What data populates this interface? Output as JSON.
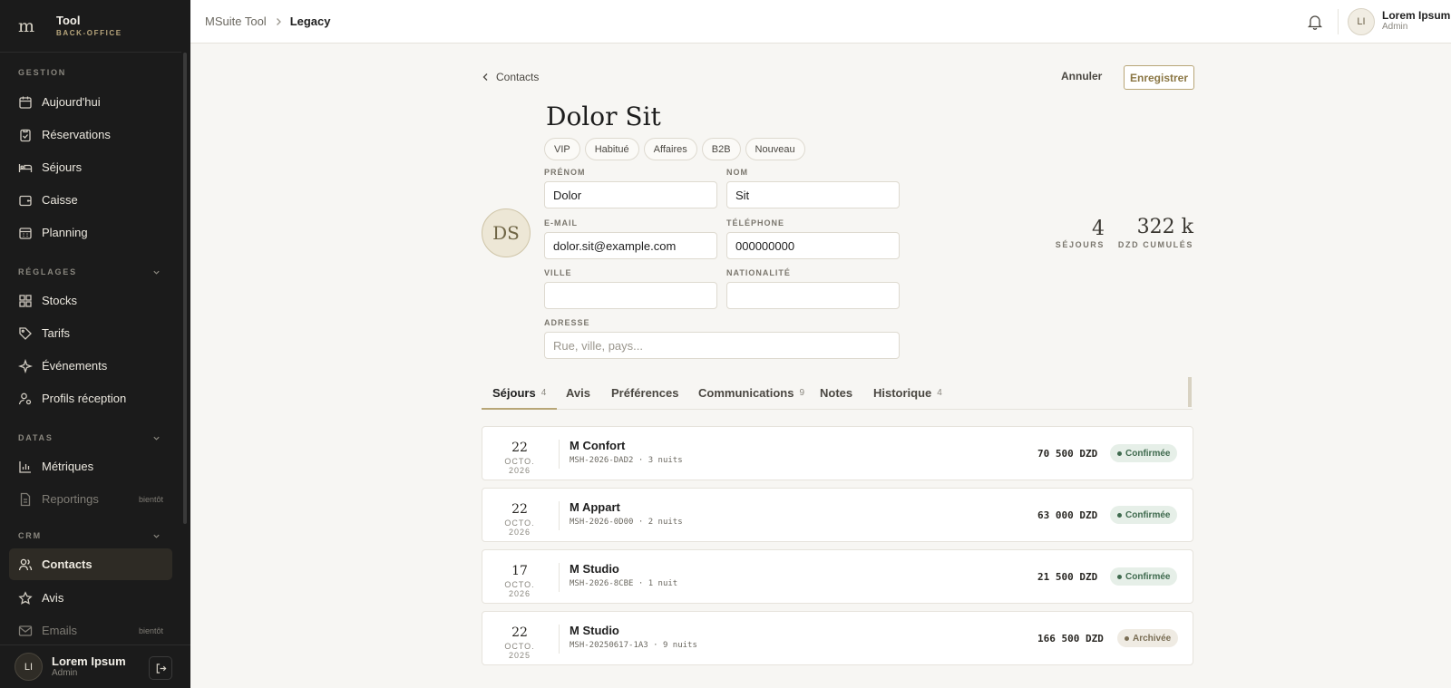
{
  "sidebar": {
    "brand": {
      "name": "Tool",
      "sub": "BACK-OFFICE"
    },
    "sections": {
      "gestion": "GESTION",
      "reglages": "RÉGLAGES",
      "datas": "DATAS",
      "crm": "CRM"
    },
    "items": [
      {
        "label": "Aujourd'hui",
        "icon": "calendar-icon"
      },
      {
        "label": "Réservations",
        "icon": "clipboard-icon"
      },
      {
        "label": "Séjours",
        "icon": "bed-icon"
      },
      {
        "label": "Caisse",
        "icon": "wallet-icon"
      },
      {
        "label": "Planning",
        "icon": "calendar-grid-icon"
      },
      {
        "label": "Stocks",
        "icon": "grid-icon"
      },
      {
        "label": "Tarifs",
        "icon": "tag-icon"
      },
      {
        "label": "Événements",
        "icon": "sparkle-icon"
      },
      {
        "label": "Profils réception",
        "icon": "user-cog-icon"
      },
      {
        "label": "Métriques",
        "icon": "bar-chart-icon"
      },
      {
        "label": "Reportings",
        "icon": "document-icon",
        "soon": "bientôt"
      },
      {
        "label": "Contacts",
        "icon": "users-icon",
        "active": true
      },
      {
        "label": "Avis",
        "icon": "star-icon"
      },
      {
        "label": "Emails",
        "icon": "mail-icon",
        "soon": "bientôt"
      }
    ],
    "user": {
      "initials": "LI",
      "name": "Lorem Ipsum",
      "role": "Admin"
    }
  },
  "topbar": {
    "breadcrumb_root": "MSuite Tool",
    "breadcrumb_current": "Legacy",
    "user": {
      "initials": "LI",
      "name": "Lorem Ipsum",
      "role": "Admin"
    }
  },
  "header": {
    "back_label": "Contacts",
    "cancel_label": "Annuler",
    "save_label": "Enregistrer",
    "full_name": "Dolor Sit",
    "initials": "DS",
    "tags": [
      "VIP",
      "Habitué",
      "Affaires",
      "B2B",
      "Nouveau"
    ]
  },
  "form": {
    "prenom": {
      "label": "PRÉNOM",
      "value": "Dolor"
    },
    "nom": {
      "label": "NOM",
      "value": "Sit"
    },
    "email": {
      "label": "E-MAIL",
      "value": "dolor.sit@example.com"
    },
    "telephone": {
      "label": "TÉLÉPHONE",
      "value": "000000000"
    },
    "ville": {
      "label": "VILLE",
      "value": ""
    },
    "nationalite": {
      "label": "NATIONALITÉ",
      "value": ""
    },
    "adresse": {
      "label": "ADRESSE",
      "value": "",
      "placeholder": "Rue, ville, pays..."
    }
  },
  "stats": {
    "sejours": {
      "value": "4",
      "label": "SÉJOURS"
    },
    "cumul": {
      "value": "322 k",
      "label": "DZD CUMULÉS"
    }
  },
  "tabs": [
    {
      "label": "Séjours",
      "count": "4",
      "active": true
    },
    {
      "label": "Avis",
      "count": ""
    },
    {
      "label": "Préférences",
      "count": ""
    },
    {
      "label": "Communications",
      "count": "9"
    },
    {
      "label": "Notes",
      "count": ""
    },
    {
      "label": "Historique",
      "count": "4"
    }
  ],
  "stays": [
    {
      "day": "22",
      "month": "OCTO. 2026",
      "title": "M Confort",
      "ref": "MSH-2026-DAD2 · 3 nuits",
      "amount": "70 500 DZD",
      "status": "Confirmée"
    },
    {
      "day": "22",
      "month": "OCTO. 2026",
      "title": "M Appart",
      "ref": "MSH-2026-0D00 · 2 nuits",
      "amount": "63 000 DZD",
      "status": "Confirmée"
    },
    {
      "day": "17",
      "month": "OCTO. 2026",
      "title": "M Studio",
      "ref": "MSH-2026-8CBE · 1 nuit",
      "amount": "21 500 DZD",
      "status": "Confirmée"
    },
    {
      "day": "22",
      "month": "OCTO. 2025",
      "title": "M Studio",
      "ref": "MSH-20250617-1A3 · 9 nuits",
      "amount": "166 500 DZD",
      "status": "Archivée"
    }
  ]
}
